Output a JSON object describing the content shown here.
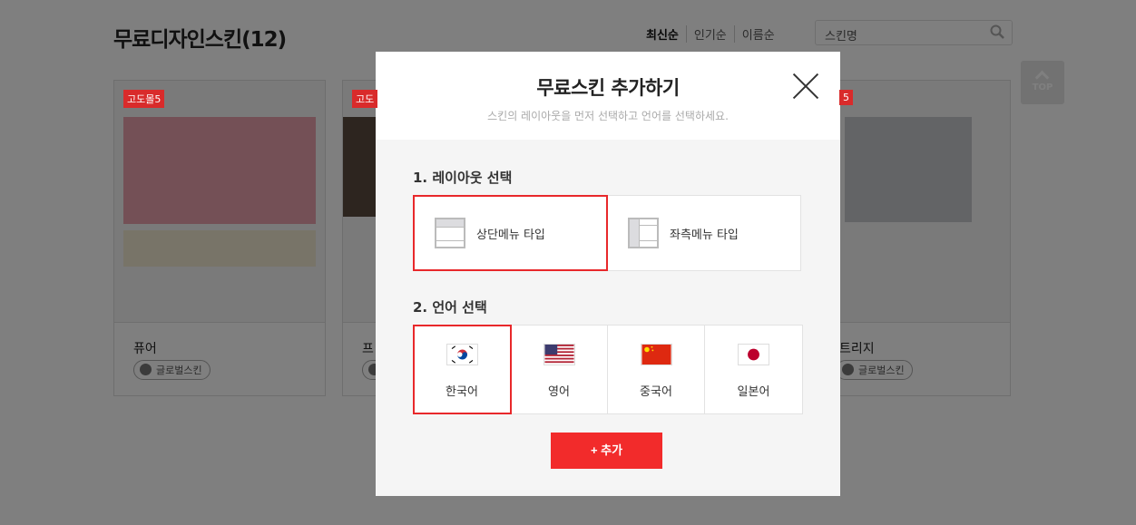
{
  "page": {
    "title": "무료디자인스킨(12)",
    "sort": [
      "최신순",
      "인기순",
      "이름순"
    ],
    "search_placeholder": "스킨명",
    "top_label": "TOP"
  },
  "cards": [
    {
      "badge": "고도몰5",
      "name": "퓨어",
      "tag": "글로벌스킨"
    },
    {
      "badge": "고도",
      "name": "프",
      "tag": "글로벌스킨"
    },
    {
      "badge": "5",
      "name": "트리지",
      "tag": "글로벌스킨"
    }
  ],
  "modal": {
    "title": "무료스킨 추가하기",
    "subtitle": "스킨의 레이아웃을 먼저 선택하고 언어를 선택하세요.",
    "layout_heading": "1. 레이아웃 선택",
    "layouts": [
      {
        "label": "상단메뉴 타입",
        "icon": "top-menu-layout-icon",
        "selected": true
      },
      {
        "label": "좌측메뉴 타입",
        "icon": "left-menu-layout-icon",
        "selected": false
      }
    ],
    "language_heading": "2. 언어 선택",
    "languages": [
      {
        "label": "한국어",
        "flag": "korea-flag",
        "selected": true
      },
      {
        "label": "영어",
        "flag": "usa-flag",
        "selected": false
      },
      {
        "label": "중국어",
        "flag": "china-flag",
        "selected": false
      },
      {
        "label": "일본어",
        "flag": "japan-flag",
        "selected": false
      }
    ],
    "add_label": "+ 추가"
  },
  "colors": {
    "accent": "#f22b2b",
    "badge": "#d92b2b"
  }
}
